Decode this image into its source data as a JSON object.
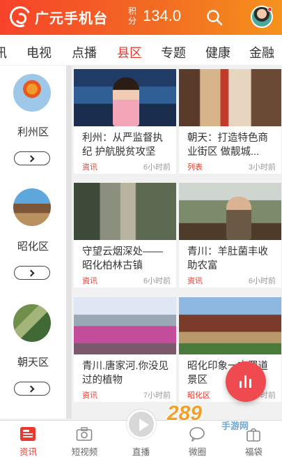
{
  "header": {
    "app_title": "广元手机台",
    "points_label": "积分",
    "points_value": "134.0"
  },
  "tabs": [
    {
      "label": "讯",
      "active": false
    },
    {
      "label": "电视",
      "active": false
    },
    {
      "label": "点播",
      "active": false
    },
    {
      "label": "县区",
      "active": true
    },
    {
      "label": "专题",
      "active": false
    },
    {
      "label": "健康",
      "active": false
    },
    {
      "label": "金融",
      "active": false
    }
  ],
  "sidebar": {
    "items": [
      {
        "label": "利州区"
      },
      {
        "label": "昭化区"
      },
      {
        "label": "朝天区"
      }
    ]
  },
  "cards": [
    {
      "title": "利州：从严监督执纪 护航脱贫攻坚",
      "tag": "资讯",
      "time": "6小时前"
    },
    {
      "title": "朝天：打造特色商业街区 做靓城...",
      "tag": "列表",
      "time": "3小时前"
    },
    {
      "title": "守望云烟深处——昭化柏林古镇",
      "tag": "资讯",
      "time": "6小时前"
    },
    {
      "title": "青川：羊肚菌丰收助农富",
      "tag": "资讯",
      "time": "6小时前"
    },
    {
      "title": "青川.唐家河.你没见过的植物",
      "tag": "资讯",
      "time": "7小时前"
    },
    {
      "title": "昭化印象一古蜀道景区",
      "tag": "昭化区",
      "time": "小时前"
    }
  ],
  "footer": {
    "items": [
      {
        "label": "资讯",
        "active": true
      },
      {
        "label": "短视频",
        "active": false
      },
      {
        "label": "直播",
        "active": false
      },
      {
        "label": "微圈",
        "active": false
      },
      {
        "label": "福袋",
        "active": false
      }
    ]
  },
  "watermark": {
    "text": "289",
    "sub": "手游网"
  },
  "colors": {
    "accent": "#e8392c",
    "header_start": "#f7432a",
    "header_end": "#f5921d"
  }
}
